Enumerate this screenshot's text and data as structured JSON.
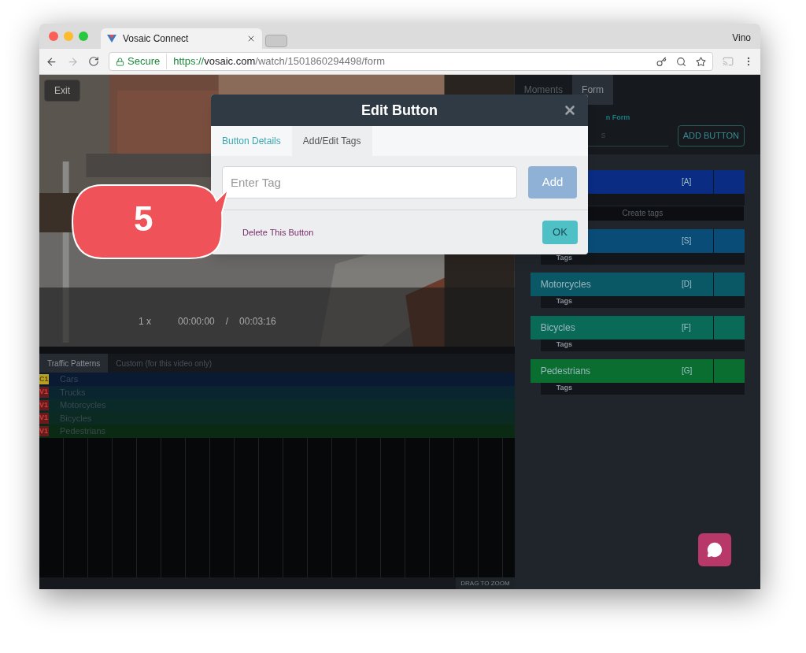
{
  "browser": {
    "tab_title": "Vosaic Connect",
    "profile": "Vino",
    "secure_label": "Secure",
    "url": {
      "scheme": "https://",
      "host": "vosaic.com",
      "path": "/watch/1501860294498/form"
    }
  },
  "video": {
    "exit": "Exit",
    "speed": "1 x",
    "time": "00:00:00",
    "separator": "/",
    "duration": "00:03:16"
  },
  "timeline": {
    "tabs": [
      {
        "label": "Traffic Patterns",
        "selected": true
      },
      {
        "label": "Custom (for this video only)",
        "selected": false
      }
    ],
    "rows": [
      {
        "badge": "C1",
        "kind": "current",
        "label": "Cars",
        "color": "#0a1a33"
      },
      {
        "badge": "V1",
        "kind": "version",
        "label": "Trucks",
        "color": "#0a2530"
      },
      {
        "badge": "V1",
        "kind": "version",
        "label": "Motorcycles",
        "color": "#0a2a2a"
      },
      {
        "badge": "V1",
        "kind": "version",
        "label": "Bicycles",
        "color": "#0a2a22"
      },
      {
        "badge": "V1",
        "kind": "version",
        "label": "Pedestrians",
        "color": "#0a2a14"
      }
    ],
    "zoom_hint": "DRAG TO ZOOM"
  },
  "panel": {
    "tabs": [
      {
        "label": "Moments",
        "selected": false
      },
      {
        "label": "Form",
        "selected": true
      }
    ],
    "form_label": "n Form",
    "select_value": "s",
    "add_button": "ADD BUTTON",
    "buttons": [
      {
        "key": "[A]",
        "color": "#0a2c82",
        "tags": "Create tags",
        "kind": "create"
      },
      {
        "key": "[S]",
        "color": "#0a4c78",
        "tags": "Tags",
        "kind": "tags"
      },
      {
        "label": "Motorcycles",
        "key": "[D]",
        "color": "#0a5866",
        "tags": "Tags",
        "kind": "tags"
      },
      {
        "label": "Bicycles",
        "key": "[F]",
        "color": "#0a6a58",
        "tags": "Tags",
        "kind": "tags"
      },
      {
        "label": "Pedestrians",
        "key": "[G]",
        "color": "#0a6e30",
        "tags": "Tags",
        "kind": "tags"
      }
    ]
  },
  "modal": {
    "title": "Edit Button",
    "tabs": [
      {
        "label": "Button Details",
        "selected": false
      },
      {
        "label": "Add/Edit Tags",
        "selected": true
      }
    ],
    "placeholder": "Enter Tag",
    "add": "Add",
    "delete": "Delete This Button",
    "ok": "OK"
  },
  "callout": {
    "number": "5"
  }
}
